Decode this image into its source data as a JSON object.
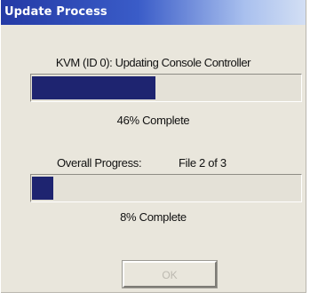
{
  "window": {
    "title": "Update Process"
  },
  "task": {
    "status_label": "KVM (ID 0): Updating Console Controller",
    "progress_percent": 46,
    "progress_text": "46% Complete"
  },
  "overall": {
    "label": "Overall Progress:",
    "file_text": "File 2 of 3",
    "progress_percent": 8,
    "progress_text": "8% Complete"
  },
  "buttons": {
    "ok_label": "OK",
    "ok_enabled": false
  },
  "colors": {
    "title_bar_start": "#243aa5",
    "title_bar_end": "#d3dff4",
    "progress_fill": "#1e2470",
    "dialog_background": "#e9e6dc"
  }
}
